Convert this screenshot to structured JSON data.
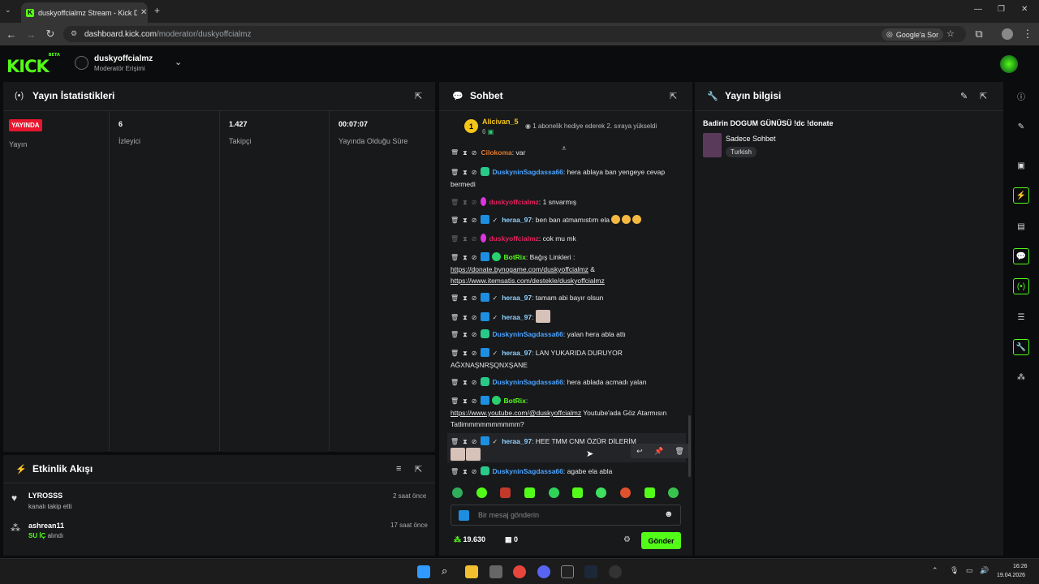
{
  "browser": {
    "tab_title": "duskyoffcialmz Stream - Kick D...",
    "url_host": "dashboard.kick.com",
    "url_path": "/moderator/duskyoffcialmz",
    "google_ask": "Google'a Sor"
  },
  "header": {
    "logo": "KICK",
    "logo_tag": "BETA",
    "channel_name": "duskyoffcialmz",
    "channel_role": "Moderatör Erişimi"
  },
  "stats": {
    "title": "Yayın İstatistikleri",
    "live_badge": "YAYINDA",
    "items": [
      {
        "value": "",
        "label": "Yayın"
      },
      {
        "value": "6",
        "label": "İzleyici"
      },
      {
        "value": "1.427",
        "label": "Takipçi"
      },
      {
        "value": "00:07:07",
        "label": "Yayında Olduğu Süre"
      }
    ]
  },
  "activity": {
    "title": "Etkinlik Akışı",
    "items": [
      {
        "name": "LYROSSS",
        "sub": "kanalı takip etti",
        "sub_highlight": "",
        "time": "2 saat önce"
      },
      {
        "name": "ashrean11",
        "sub": "alındı",
        "sub_highlight": "SU İÇ",
        "time": "17 saat önce"
      }
    ]
  },
  "chat": {
    "title": "Sohbet",
    "pinned_user": "Alicivan_5",
    "pinned_rank": "1",
    "pinned_count": "6",
    "pinned_text": "1 abonelik hediye ederek 2. sıraya yükseldi",
    "messages": [
      {
        "user": "Cilokoma",
        "text": ": var"
      },
      {
        "user": "DuskyninSagdassa66",
        "text": ": hera ablaya ban yengeye cevap bermedi"
      },
      {
        "user": "duskyoffcialmz",
        "text": ": 1 snvarmış"
      },
      {
        "user": "heraa_97",
        "text": ": ben ban atmamıstım ela"
      },
      {
        "user": "duskyoffcialmz",
        "text": ": cok mu mk"
      },
      {
        "user": "BotRix",
        "text": ": Bağış Linkleri :",
        "link1": "https://donate.bynogame.com/duskyoffcialmz",
        "link1_tail": " &",
        "link2": "https://www.itemsatis.com/destekle/duskyoffcialmz"
      },
      {
        "user": "heraa_97",
        "text": ": tamam abi bayır olsun"
      },
      {
        "user": "heraa_97",
        "text": ":"
      },
      {
        "user": "DuskyninSagdassa66",
        "text": ": yalan hera abla attı"
      },
      {
        "user": "heraa_97",
        "text": ": LAN YUKARIDA DURUYOR AĞXNAŞNRŞQNXŞANE"
      },
      {
        "user": "DuskyninSagdassa66",
        "text": ": hera ablada acmadı yalan"
      },
      {
        "user": "BotRix",
        "text": ":",
        "link1": "https://www.youtube.com/@duskyoffcialmz",
        "link1_tail": " Youtube'ada Göz Atarmısın Tatlimmmmmmmmmm?"
      },
      {
        "user": "heraa_97",
        "text": ": HEE TMM CNM ÖZÜR DİLERİM"
      },
      {
        "user": "DuskyninSagdassa66",
        "text": ": agabe ela abla"
      }
    ],
    "input_placeholder": "Bir mesaj gönderin",
    "points": "19.630",
    "gift_count": "0",
    "send_label": "Gönder"
  },
  "stream_info": {
    "title": "Yayın bilgisi",
    "stream_title": "Badirin DOGUM GÜNÜSÜ !dc !donate",
    "category": "Sadece Sohbet",
    "tag": "Turkish"
  },
  "taskbar": {
    "time": "16:26",
    "date": "19.04.2026"
  },
  "colors": {
    "accent": "#53fc18",
    "live": "#e6162d",
    "panel": "#18191b",
    "background": "#0b0c0d"
  }
}
